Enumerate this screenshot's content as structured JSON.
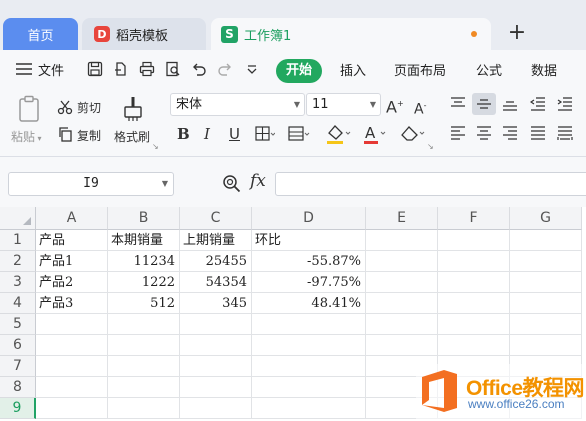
{
  "tabs": [
    {
      "label": "首页"
    },
    {
      "label": "稻壳模板",
      "icon": "docer-logo-icon"
    },
    {
      "label": "工作簿1",
      "icon": "spreadsheet-logo-icon"
    }
  ],
  "new_tab_glyph": "+",
  "menu": {
    "file": "文件",
    "start": "开始",
    "insert": "插入",
    "page_layout": "页面布局",
    "formulas": "公式",
    "data": "数据"
  },
  "ribbon": {
    "paste": "粘贴",
    "cut": "剪切",
    "copy": "复制",
    "format_painter": "格式刷",
    "font_name": "宋体",
    "font_size": "11",
    "bold": "B",
    "italic": "I",
    "underline": "U"
  },
  "formula_bar": {
    "cell_ref": "I9",
    "fx": "fx",
    "formula": ""
  },
  "grid": {
    "columns": [
      "A",
      "B",
      "C",
      "D",
      "E",
      "F",
      "G"
    ],
    "rows": [
      "1",
      "2",
      "3",
      "4",
      "5",
      "6",
      "7",
      "8",
      "9"
    ],
    "cells": [
      [
        "产品",
        "本期销量",
        "上期销量",
        "环比"
      ],
      [
        "产品1",
        "11234",
        "25455",
        "-55.87%"
      ],
      [
        "产品2",
        "1222",
        "54354",
        "-97.75%"
      ],
      [
        "产品3",
        "512",
        "345",
        "48.41%"
      ]
    ],
    "selected_row": "9"
  },
  "watermark": {
    "brand": "Office教程网",
    "url": "www.office26.com"
  },
  "colors": {
    "accent_green": "#22a85f",
    "home_tab_blue": "#5b8def",
    "watermark_orange": "#f39200"
  }
}
